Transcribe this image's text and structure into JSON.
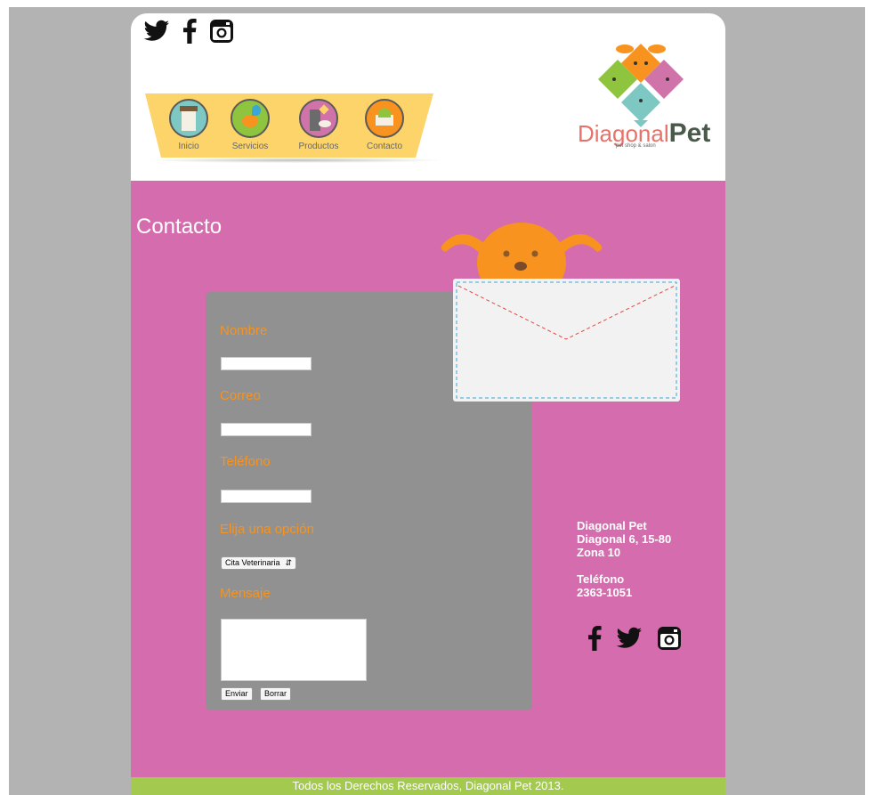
{
  "header": {
    "social": [
      {
        "icon": "twitter-icon"
      },
      {
        "icon": "facebook-icon"
      },
      {
        "icon": "instagram-icon"
      }
    ],
    "nav": [
      {
        "label": "Inicio",
        "color": "#7ec8c4"
      },
      {
        "label": "Servicios",
        "color": "#8fc43f"
      },
      {
        "label": "Productos",
        "color": "#cf73a8"
      },
      {
        "label": "Contacto",
        "color": "#f7931e"
      }
    ],
    "logo": {
      "part1": "Diagonal",
      "part2": "Pet",
      "tagline": "pet shop & salon"
    }
  },
  "content": {
    "title": "Contacto",
    "form": {
      "name_label": "Nombre",
      "email_label": "Correo",
      "phone_label": "Teléfono",
      "option_label": "Elija una opción",
      "option_selected": "Cita Veterinaria",
      "message_label": "Mensaje",
      "submit_label": "Enviar",
      "reset_label": "Borrar"
    },
    "address": {
      "line1": "Diagonal Pet",
      "line2": "Diagonal 6, 15-80",
      "line3": "Zona 10",
      "phone_label": "Teléfono",
      "phone": "2363-1051"
    },
    "social": [
      {
        "icon": "facebook-icon"
      },
      {
        "icon": "twitter-icon"
      },
      {
        "icon": "instagram-icon"
      }
    ]
  },
  "footer": {
    "text": "Todos los Derechos Reservados, Diagonal Pet 2013."
  },
  "colors": {
    "content_bg": "#d56cae",
    "accent": "#f7931e",
    "footer": "#a3c94e",
    "panel": "#919191"
  }
}
